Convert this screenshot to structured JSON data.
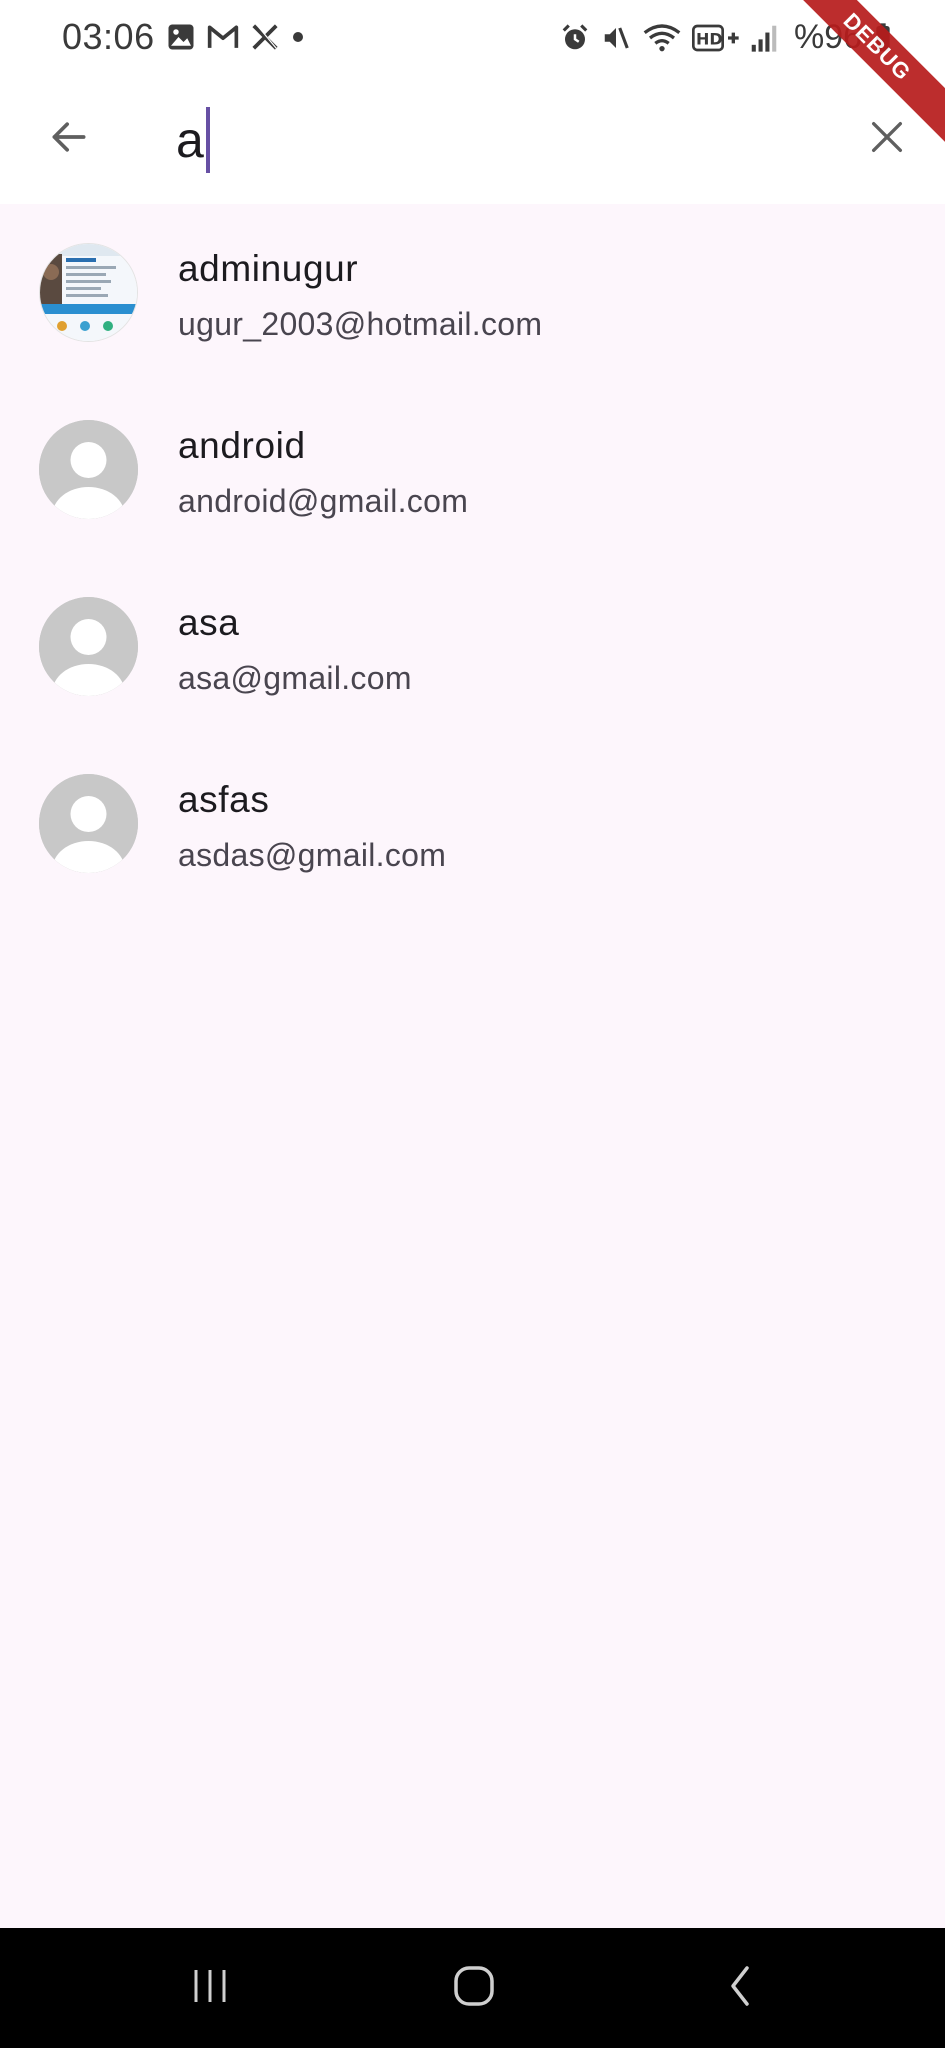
{
  "status_bar": {
    "time": "03:06",
    "battery": "%96",
    "left_icons": [
      "gallery-icon",
      "gmail-icon",
      "x-icon",
      "dot-icon"
    ],
    "right_icons": [
      "alarm-icon",
      "mute-icon",
      "wifi-icon",
      "hd-plus-icon",
      "signal-icon",
      "battery-icon"
    ]
  },
  "debug_banner": "DEBUG",
  "search": {
    "query": "a",
    "back_icon": "arrow-back-icon",
    "clear_icon": "close-icon"
  },
  "results": [
    {
      "name": "adminugur",
      "email": "ugur_2003@hotmail.com",
      "avatar": "photo"
    },
    {
      "name": "android",
      "email": "android@gmail.com",
      "avatar": "default-person"
    },
    {
      "name": "asa",
      "email": "asa@gmail.com",
      "avatar": "default-person"
    },
    {
      "name": "asfas",
      "email": "asdas@gmail.com",
      "avatar": "default-person"
    }
  ],
  "nav_bar": {
    "buttons": [
      "recent-apps-icon",
      "home-icon",
      "back-icon"
    ]
  },
  "colors": {
    "background": "#fdf6fc",
    "appbar": "#ffffff",
    "caret": "#6750a4",
    "debug": "#b71c1c",
    "navbar": "#000000"
  }
}
